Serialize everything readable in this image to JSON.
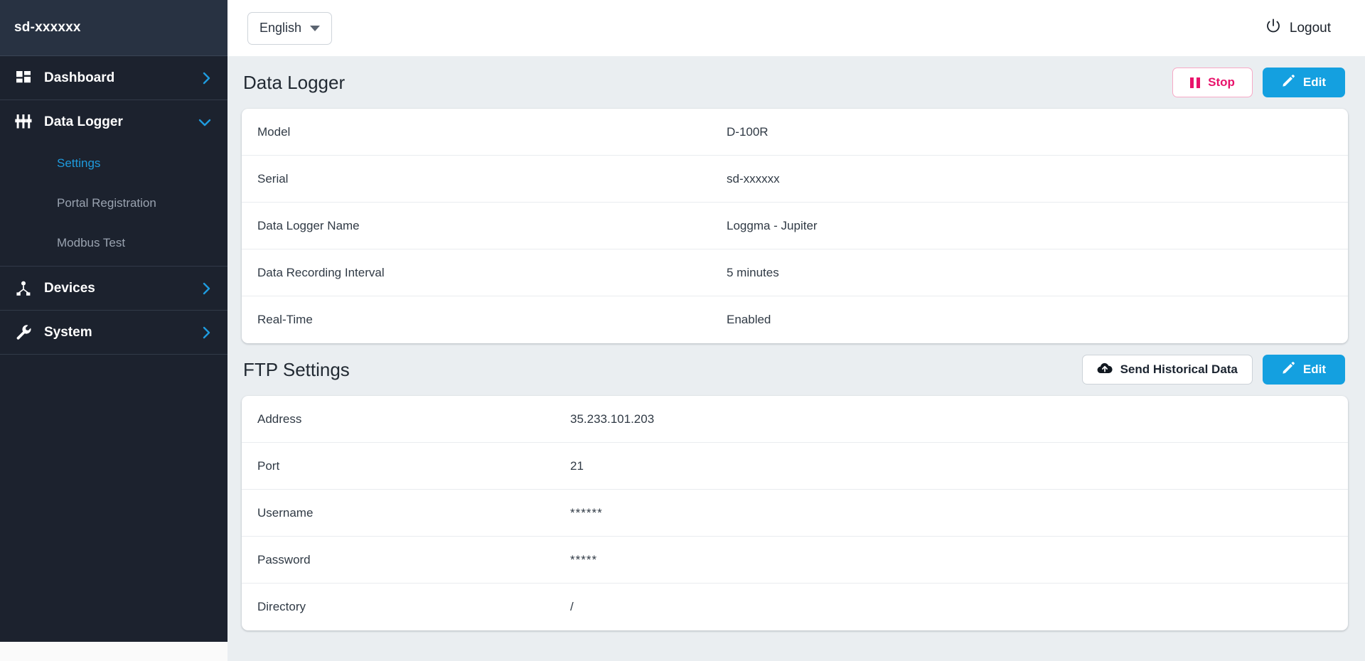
{
  "sidebar": {
    "brand": "sd-xxxxxx",
    "items": [
      {
        "label": "Dashboard",
        "icon": "grid-dashboard-icon",
        "chevron": "chevron-right",
        "expanded": false
      },
      {
        "label": "Data Logger",
        "icon": "sliders-icon",
        "chevron": "chevron-down",
        "expanded": true,
        "children": [
          {
            "label": "Settings",
            "active": true
          },
          {
            "label": "Portal Registration",
            "active": false
          },
          {
            "label": "Modbus Test",
            "active": false
          }
        ]
      },
      {
        "label": "Devices",
        "icon": "device-network-icon",
        "chevron": "chevron-right",
        "expanded": false
      },
      {
        "label": "System",
        "icon": "wrench-icon",
        "chevron": "chevron-right",
        "expanded": false
      }
    ]
  },
  "topbar": {
    "language": "English",
    "logout_label": "Logout",
    "logout_icon": "power-icon",
    "caret_icon": "chevron-down-icon"
  },
  "sections": [
    {
      "id": "data-logger",
      "title": "Data Logger",
      "buttons": [
        {
          "label": "Stop",
          "style": "stop",
          "icon": "pause-icon"
        },
        {
          "label": "Edit",
          "style": "edit",
          "icon": "pencil-icon"
        }
      ],
      "rows": [
        {
          "label": "Model",
          "value": "D-100R"
        },
        {
          "label": "Serial",
          "value": "sd-xxxxxx"
        },
        {
          "label": "Data Logger Name",
          "value": "Loggma - Jupiter"
        },
        {
          "label": "Data Recording Interval",
          "value": "5 minutes"
        },
        {
          "label": "Real-Time",
          "value": "Enabled"
        }
      ]
    },
    {
      "id": "ftp-settings",
      "title": "FTP Settings",
      "buttons": [
        {
          "label": "Send Historical Data",
          "style": "ghost",
          "icon": "cloud-upload-icon"
        },
        {
          "label": "Edit",
          "style": "edit",
          "icon": "pencil-icon"
        }
      ],
      "rows": [
        {
          "label": "Address",
          "value": "35.233.101.203"
        },
        {
          "label": "Port",
          "value": "21"
        },
        {
          "label": "Username",
          "value": "******"
        },
        {
          "label": "Password",
          "value": "*****"
        },
        {
          "label": "Directory",
          "value": "/"
        }
      ]
    }
  ],
  "colors": {
    "sidebar_bg": "#1c222e",
    "sidebar_header_bg": "#283242",
    "accent_blue": "#14a0e0",
    "link_blue": "#1f9bde",
    "danger_pink": "#e8136b",
    "content_bg": "#eaeef1"
  }
}
